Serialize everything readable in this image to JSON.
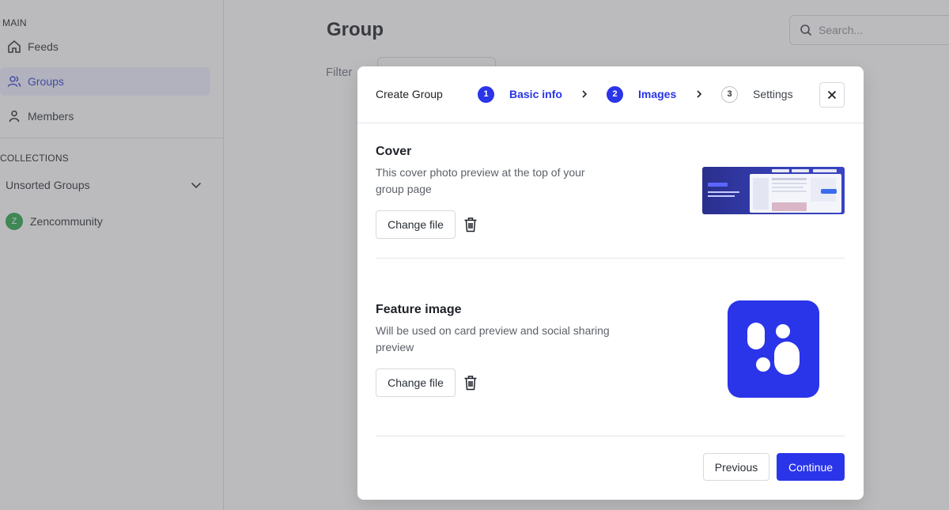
{
  "sidebar": {
    "main_title": "MAIN",
    "items": [
      {
        "label": "Feeds",
        "icon": "home-icon"
      },
      {
        "label": "Groups",
        "icon": "users-icon",
        "active": true
      },
      {
        "label": "Members",
        "icon": "user-icon"
      }
    ],
    "collections_title": "COLLECTIONS",
    "collection_dropdown": "Unsorted Groups",
    "collection_item": {
      "label": "Zencommunity",
      "avatar_letter": "Z"
    }
  },
  "header": {
    "title": "Group",
    "search_placeholder": "Search...",
    "filter_label": "Filter"
  },
  "modal": {
    "title": "Create Group",
    "steps": [
      {
        "number": "1",
        "label": "Basic info",
        "state": "done"
      },
      {
        "number": "2",
        "label": "Images",
        "state": "current"
      },
      {
        "number": "3",
        "label": "Settings",
        "state": "todo"
      }
    ],
    "cover": {
      "title": "Cover",
      "description": "This cover photo preview at the top of your group page",
      "button": "Change file"
    },
    "feature": {
      "title": "Feature image",
      "description": "Will be used on card preview and social sharing preview",
      "button": "Change file"
    },
    "footer": {
      "previous": "Previous",
      "continue": "Continue"
    }
  },
  "colors": {
    "accent": "#2a34e8",
    "avatar": "#2aa64a"
  }
}
